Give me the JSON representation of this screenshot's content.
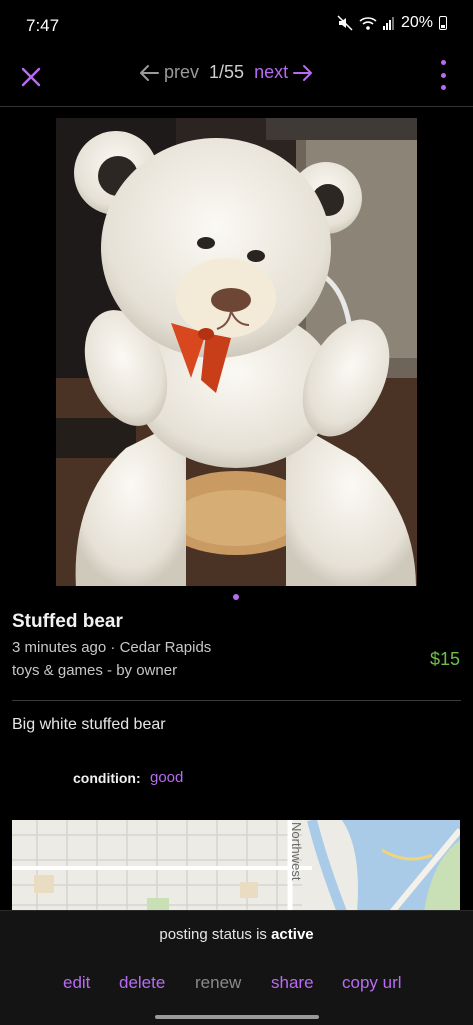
{
  "status_bar": {
    "time": "7:47",
    "battery": "20%"
  },
  "nav": {
    "prev_label": "prev",
    "counter": "1/55",
    "next_label": "next"
  },
  "listing": {
    "title": "Stuffed bear",
    "posted": "3 minutes ago",
    "separator": " · ",
    "location": "Cedar Rapids",
    "category": "toys & games - by owner",
    "price": "$15",
    "description": "Big white stuffed bear",
    "condition_label": "condition:",
    "condition_value": "good",
    "photo_count": 55,
    "current_photo": 1
  },
  "map": {
    "street_label": "Northwest"
  },
  "posting_status": {
    "prefix": "posting status is ",
    "value": "active"
  },
  "actions": {
    "edit": "edit",
    "delete": "delete",
    "renew": "renew",
    "share": "share",
    "copy_url": "copy url"
  },
  "colors": {
    "accent": "#b86bf2",
    "price": "#6cc04a",
    "background": "#000000"
  },
  "icons": [
    "mute-icon",
    "wifi-icon",
    "signal-icon",
    "battery-icon",
    "close-icon",
    "arrow-left-icon",
    "arrow-right-icon",
    "more-vertical-icon"
  ]
}
